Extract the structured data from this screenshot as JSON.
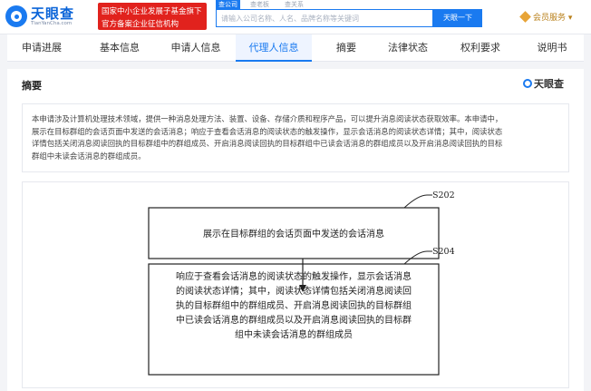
{
  "header": {
    "logo_name": "天眼查",
    "logo_domain": "TianYanCha.com",
    "gov_line1": "国家中小企业发展子基金旗下",
    "gov_line2": "官方备案企业征信机构",
    "search_tabs": [
      "查公司",
      "查老板",
      "查关系"
    ],
    "search_placeholder": "请输入公司名称、人名、品牌名称等关键词",
    "search_button": "天眼一下",
    "vip_label": "会员服务 ▾"
  },
  "tabs": [
    {
      "label": "申请进展"
    },
    {
      "label": "基本信息"
    },
    {
      "label": "申请人信息"
    },
    {
      "label": "代理人信息",
      "active": true
    },
    {
      "label": "摘要"
    },
    {
      "label": "法律状态"
    },
    {
      "label": "权利要求"
    },
    {
      "label": "说明书"
    }
  ],
  "content": {
    "title": "摘要",
    "brand": "天眼查",
    "abstract_lines": [
      "本申请涉及计算机处理技术领域，提供一种消息处理方法、装置、设备、存储介质和程序产品，可以提升消息阅读状态获取效率。本申请中，",
      "展示在目标群组的会话页面中发送的会话消息；响应于查看会话消息的阅读状态的触发操作，显示会话消息的阅读状态详情；其中，阅读状态",
      "详情包括关闭消息阅读回执的目标群组中的群组成员、开启消息阅读回执的目标群组中已读会话消息的群组成员以及开启消息阅读回执的目标",
      "群组中未读会话消息的群组成员。"
    ]
  },
  "diagram": {
    "step1_label": "S202",
    "step1_text": "展示在目标群组的会话页面中发送的会话消息",
    "step2_label": "S204",
    "step2_lines": [
      "响应于查看会话消息的阅读状态的触发操作，显示会话消息",
      "的阅读状态详情；其中，阅读状态详情包括关闭消息阅读回",
      "执的目标群组中的群组成员、开启消息阅读回执的目标群组",
      "中已读会话消息的群组成员以及开启消息阅读回执的目标群",
      "组中未读会话消息的群组成员"
    ]
  },
  "colors": {
    "accent": "#1a7af0",
    "gov_red": "#e1221d",
    "vip_gold": "#b9801b"
  }
}
